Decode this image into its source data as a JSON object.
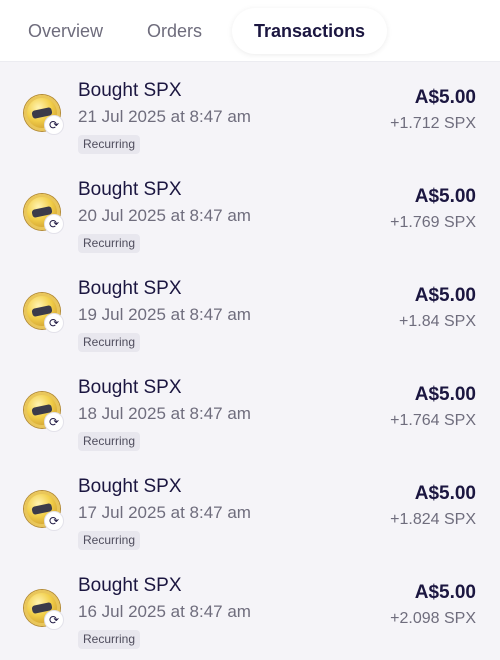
{
  "tabs": [
    {
      "label": "Overview"
    },
    {
      "label": "Orders"
    },
    {
      "label": "Transactions"
    }
  ],
  "active_tab": "Transactions",
  "transactions": [
    {
      "title": "Bought SPX",
      "date": "21 Jul 2025 at 8:47 am",
      "tag": "Recurring",
      "amount": "A$5.00",
      "quantity": "+1.712 SPX",
      "icon": "spx-coin-icon"
    },
    {
      "title": "Bought SPX",
      "date": "20 Jul 2025 at 8:47 am",
      "tag": "Recurring",
      "amount": "A$5.00",
      "quantity": "+1.769 SPX",
      "icon": "spx-coin-icon"
    },
    {
      "title": "Bought SPX",
      "date": "19 Jul 2025 at 8:47 am",
      "tag": "Recurring",
      "amount": "A$5.00",
      "quantity": "+1.84 SPX",
      "icon": "spx-coin-icon"
    },
    {
      "title": "Bought SPX",
      "date": "18 Jul 2025 at 8:47 am",
      "tag": "Recurring",
      "amount": "A$5.00",
      "quantity": "+1.764 SPX",
      "icon": "spx-coin-icon"
    },
    {
      "title": "Bought SPX",
      "date": "17 Jul 2025 at 8:47 am",
      "tag": "Recurring",
      "amount": "A$5.00",
      "quantity": "+1.824 SPX",
      "icon": "spx-coin-icon"
    },
    {
      "title": "Bought SPX",
      "date": "16 Jul 2025 at 8:47 am",
      "tag": "Recurring",
      "amount": "A$5.00",
      "quantity": "+2.098 SPX",
      "icon": "spx-coin-icon"
    }
  ],
  "colors": {
    "background": "#f5f4f8",
    "text_primary": "#1b1640",
    "text_secondary": "#6f6d7d",
    "tag_bg": "#e8e7ee"
  }
}
